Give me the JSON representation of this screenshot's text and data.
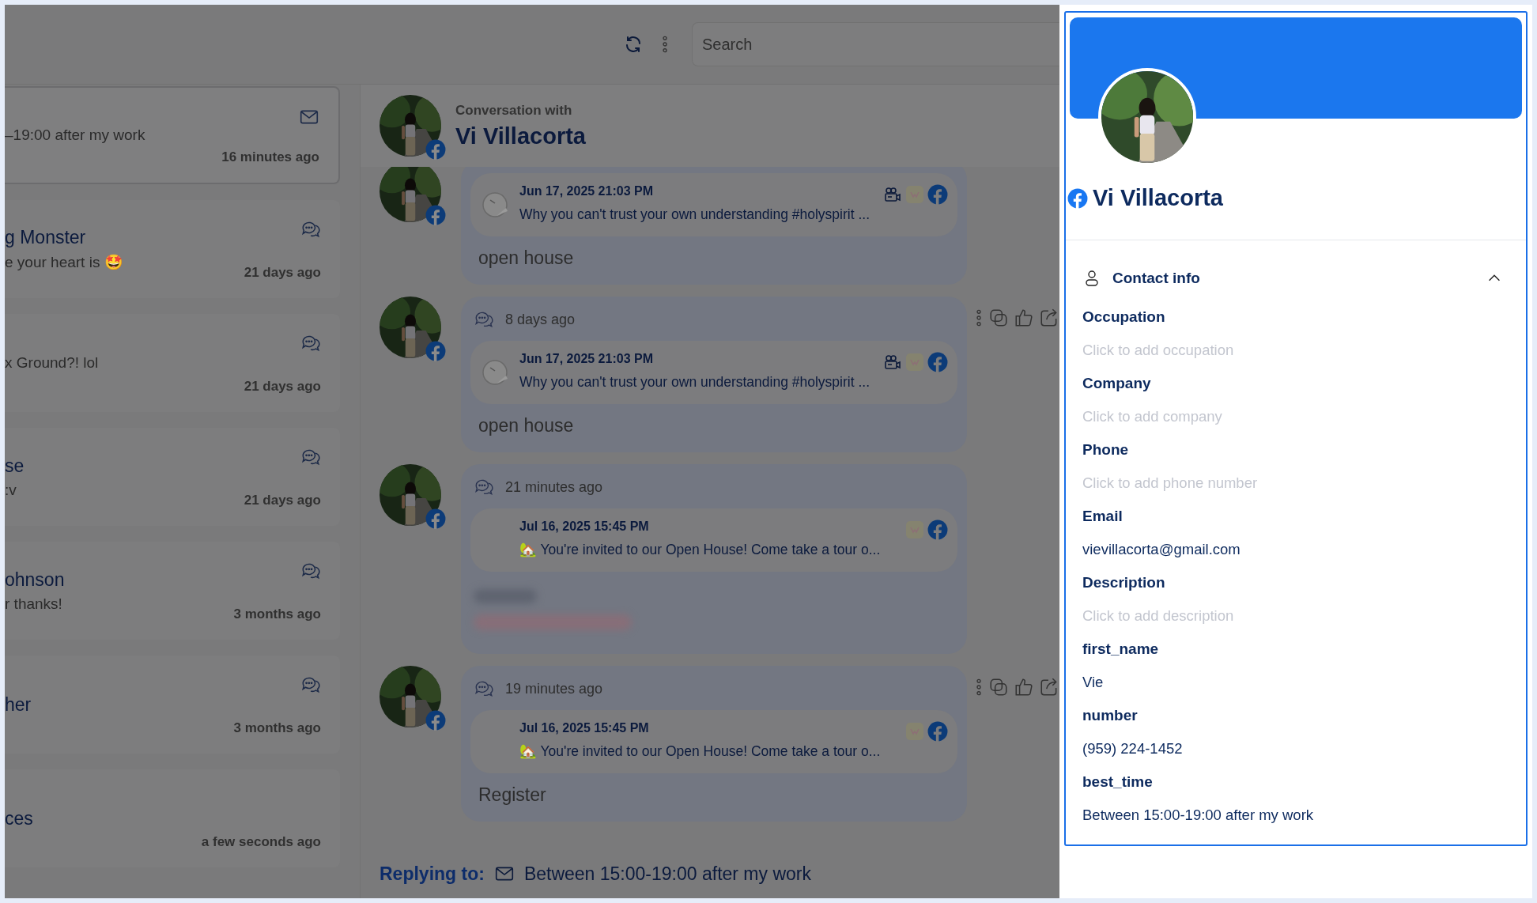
{
  "top_bar": {
    "search": {
      "placeholder": "Search"
    }
  },
  "conversations": [
    {
      "kind": "email",
      "preview": "–19:00 after my work",
      "time": "16 minutes ago",
      "selected": true
    },
    {
      "kind": "message",
      "name": "g Monster",
      "preview": "e your heart is 🤩",
      "time": "21 days ago",
      "selected": false
    },
    {
      "kind": "message",
      "preview": "x Ground?! lol",
      "time": "21 days ago",
      "selected": false
    },
    {
      "kind": "message",
      "name": "se",
      "preview": ":v",
      "time": "21 days ago",
      "selected": false
    },
    {
      "kind": "message",
      "name": "ohnson",
      "preview": "r thanks!",
      "time": "3 months ago",
      "selected": false
    },
    {
      "kind": "message",
      "name": "her",
      "time": "3 months ago",
      "selected": false
    },
    {
      "kind": "other",
      "name": "ces",
      "time": "a few seconds ago",
      "selected": false
    }
  ],
  "conversation": {
    "label": "Conversation with",
    "name": "Vi Villacorta",
    "messages": [
      {
        "kind": "text",
        "post": {
          "date": "Jun 17, 2025 21:03 PM",
          "text": "Why you can't trust your own understanding #holyspirit ...",
          "thumbnail": true,
          "video": true
        },
        "body": "open house",
        "actions": false
      },
      {
        "kind": "text",
        "time": "8 days ago",
        "post": {
          "date": "Jun 17, 2025 21:03 PM",
          "text": "Why you can't trust your own understanding #holyspirit ...",
          "thumbnail": true,
          "video": true
        },
        "body": "open house",
        "actions": true
      },
      {
        "kind": "blurred",
        "time": "21 minutes ago",
        "post": {
          "date": "Jul 16, 2025 15:45 PM",
          "text": "🏡 You're invited to our Open House! Come take a tour o...",
          "thumbnail": false,
          "video": false
        },
        "actions": false
      },
      {
        "kind": "text",
        "time": "19 minutes ago",
        "post": {
          "date": "Jul 16, 2025 15:45 PM",
          "text": "🏡 You're invited to our Open House! Come take a tour o...",
          "thumbnail": false,
          "video": false
        },
        "body": "Register",
        "actions": true
      }
    ]
  },
  "reply": {
    "label": "Replying to:",
    "text": "Between 15:00-19:00 after my work"
  },
  "contact_panel": {
    "name": "Vi Villacorta",
    "section": {
      "title": "Contact info",
      "expanded": true
    },
    "fields": [
      {
        "label": "Occupation",
        "placeholder": "Click to add occupation"
      },
      {
        "label": "Company",
        "placeholder": "Click to add company"
      },
      {
        "label": "Phone",
        "placeholder": "Click to add phone number"
      },
      {
        "label": "Email",
        "value": "vievillacorta@gmail.com"
      },
      {
        "label": "Description",
        "placeholder": "Click to add description"
      },
      {
        "label": "first_name",
        "value": "Vie"
      },
      {
        "label": "number",
        "value": "(959) 224-1452"
      },
      {
        "label": "best_time",
        "value": "Between 15:00-19:00 after my work"
      }
    ]
  }
}
